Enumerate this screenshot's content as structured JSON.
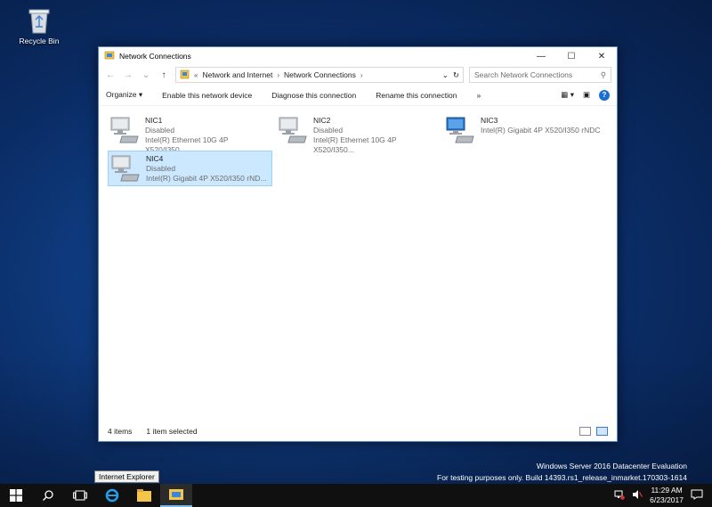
{
  "desktop": {
    "recycle_bin_label": "Recycle Bin"
  },
  "window": {
    "title": "Network Connections",
    "controls": {
      "minimize": "—",
      "maximize": "☐",
      "close": "✕"
    },
    "address": {
      "prefix": "«",
      "crumbs": [
        "Network and Internet",
        "Network Connections"
      ]
    },
    "search_placeholder": "Search Network Connections",
    "toolbar": {
      "organize": "Organize",
      "enable": "Enable this network device",
      "diagnose": "Diagnose this connection",
      "rename": "Rename this connection",
      "more": "»",
      "help": "?"
    },
    "items": [
      {
        "name": "NIC1",
        "status": "Disabled",
        "desc": "Intel(R) Ethernet 10G 4P X520/I350..."
      },
      {
        "name": "NIC2",
        "status": "Disabled",
        "desc": "Intel(R) Ethernet 10G 4P X520/I350..."
      },
      {
        "name": "NIC3",
        "status": "",
        "desc": "Intel(R) Gigabit 4P X520/I350 rNDC"
      },
      {
        "name": "NIC4",
        "status": "Disabled",
        "desc": "Intel(R) Gigabit 4P X520/I350 rND..."
      }
    ],
    "statusbar": {
      "count": "4 items",
      "selected": "1 item selected"
    }
  },
  "watermark": {
    "line1": "Windows Server 2016 Datacenter Evaluation",
    "line2": "For testing purposes only. Build 14393.rs1_release_inmarket.170303-1614"
  },
  "tooltip": "Internet Explorer",
  "taskbar": {
    "time": "11:29 AM",
    "date": "6/23/2017"
  },
  "colors": {
    "accent": "#1b6ed1",
    "selection": "#cce8ff",
    "taskbar": "#101010"
  }
}
